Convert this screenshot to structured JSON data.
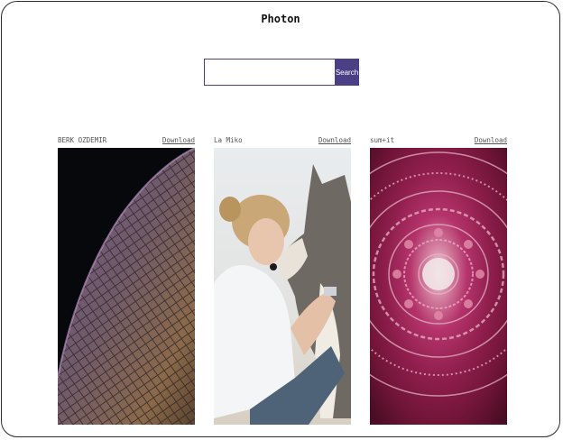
{
  "app": {
    "title": "Photon"
  },
  "search": {
    "value": "",
    "placeholder": "",
    "button_label": "Search"
  },
  "photos": [
    {
      "author": "BERK OZDEMIR",
      "download_label": "Download",
      "subject": "curved glass building at night"
    },
    {
      "author": "La Miko",
      "download_label": "Download",
      "subject": "woman hugging husky dog"
    },
    {
      "author": "sum+it",
      "download_label": "Download",
      "subject": "pink ornate circular mandala"
    }
  ],
  "colors": {
    "accent": "#4b3f86",
    "border": "#2b2b2b"
  }
}
